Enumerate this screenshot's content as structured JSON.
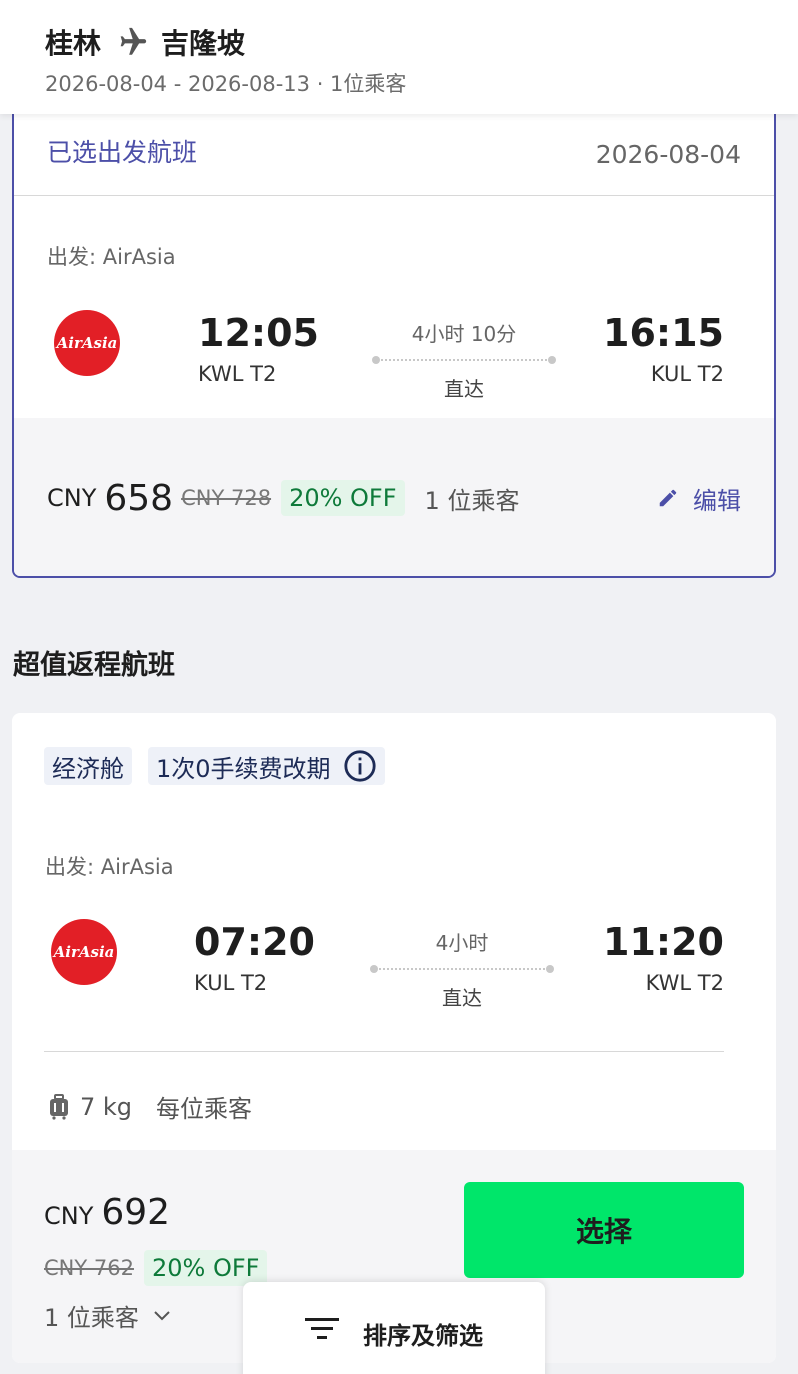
{
  "header": {
    "origin": "桂林",
    "destination": "吉隆坡",
    "subtitle": "2026-08-04 - 2026-08-13 · 1位乘客"
  },
  "outbound": {
    "label": "已选出发航班",
    "date": "2026-08-04",
    "airline_label": "出发: AirAsia",
    "logo_text": "AirAsia",
    "depart_time": "12:05",
    "depart_airport": "KWL T2",
    "duration": "4小时 10分",
    "stops": "直达",
    "arrive_time": "16:15",
    "arrive_airport": "KUL T2",
    "currency": "CNY",
    "price": "658",
    "old_price": "CNY 728",
    "discount": "20% OFF",
    "passengers": "1 位乘客",
    "edit_label": "编辑"
  },
  "return_section": {
    "title": "超值返程航班"
  },
  "return": {
    "tags": [
      "经济舱",
      "1次0手续费改期"
    ],
    "airline_label": "出发: AirAsia",
    "logo_text": "AirAsia",
    "depart_time": "07:20",
    "depart_airport": "KUL T2",
    "duration": "4小时",
    "stops": "直达",
    "arrive_time": "11:20",
    "arrive_airport": "KWL T2",
    "baggage_weight": "7 kg",
    "baggage_note": "每位乘客",
    "currency": "CNY",
    "price": "692",
    "old_price": "CNY 762",
    "discount": "20% OFF",
    "passengers": "1 位乘客",
    "select_label": "选择"
  },
  "sort_filter": {
    "label": "排序及筛选"
  },
  "colors": {
    "accent": "#4c4fa8",
    "select_green": "#00e66a",
    "discount_green": "#0e7a3a",
    "airasia_red": "#e21f26"
  }
}
